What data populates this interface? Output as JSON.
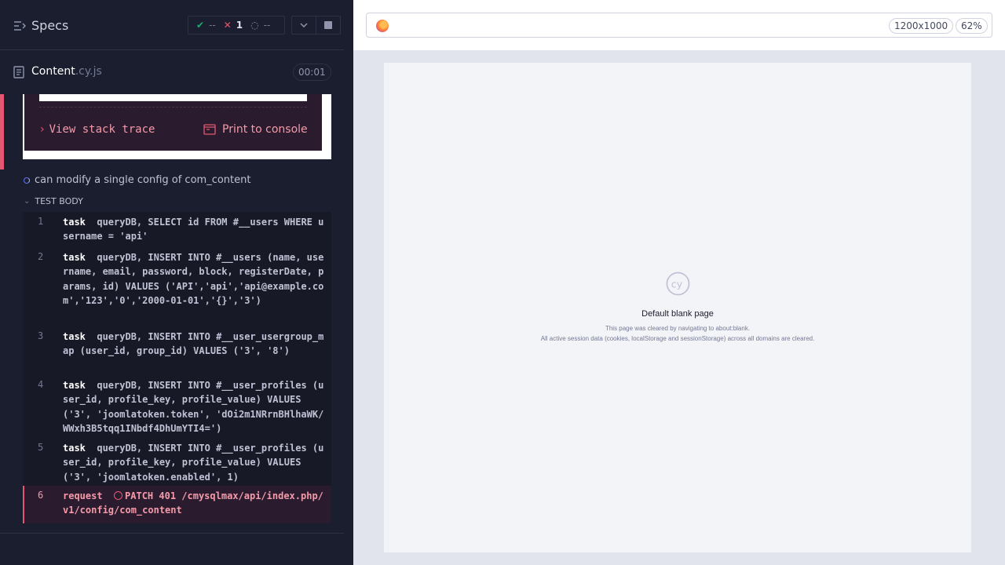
{
  "header": {
    "title": "Specs",
    "stats": {
      "passed": "--",
      "failed": "1",
      "pending": "--"
    }
  },
  "spec": {
    "name": "Content",
    "ext": ".cy.js",
    "duration": "00:01"
  },
  "error": {
    "view_stack_trace": "View stack trace",
    "print_to_console": "Print to console"
  },
  "test": {
    "title": "can modify a single config of com_content",
    "body_label": "TEST BODY",
    "commands": [
      {
        "num": "1",
        "name": "task",
        "message": "queryDB, SELECT id FROM #__users WHERE username = 'api'"
      },
      {
        "num": "2",
        "name": "task",
        "message": "queryDB, INSERT INTO #__users (name, username, email, password, block, registerDate, params, id) VALUES ('API','api','api@example.com','123','0','2000-01-01','{}','3')"
      },
      {
        "num": "3",
        "name": "task",
        "message": "queryDB, INSERT INTO #__user_usergroup_map (user_id, group_id) VALUES ('3', '8')"
      },
      {
        "num": "4",
        "name": "task",
        "message": "queryDB, INSERT INTO #__user_profiles (user_id, profile_key, profile_value) VALUES ('3', 'joomlatoken.token', 'dOi2m1NRrnBHlhaWK/WWxh3B5tqq1INbdf4DhUmYTI4=')"
      },
      {
        "num": "5",
        "name": "task",
        "message": "queryDB, INSERT INTO #__user_profiles (user_id, profile_key, profile_value) VALUES ('3', 'joomlatoken.enabled', 1)"
      },
      {
        "num": "6",
        "name": "request",
        "message": "PATCH 401 /cmysqlmax/api/index.php/v1/config/com_content"
      }
    ]
  },
  "aut": {
    "viewport": "1200x1000",
    "zoom": "62%",
    "blank_title": "Default blank page",
    "blank_line1": "This page was cleared by navigating to about:blank.",
    "blank_line2": "All active session data (cookies, localStorage and sessionStorage) across all domains are cleared."
  },
  "colors": {
    "failed": "#e45770",
    "passed": "#1fa971",
    "accent": "#6470f3"
  }
}
